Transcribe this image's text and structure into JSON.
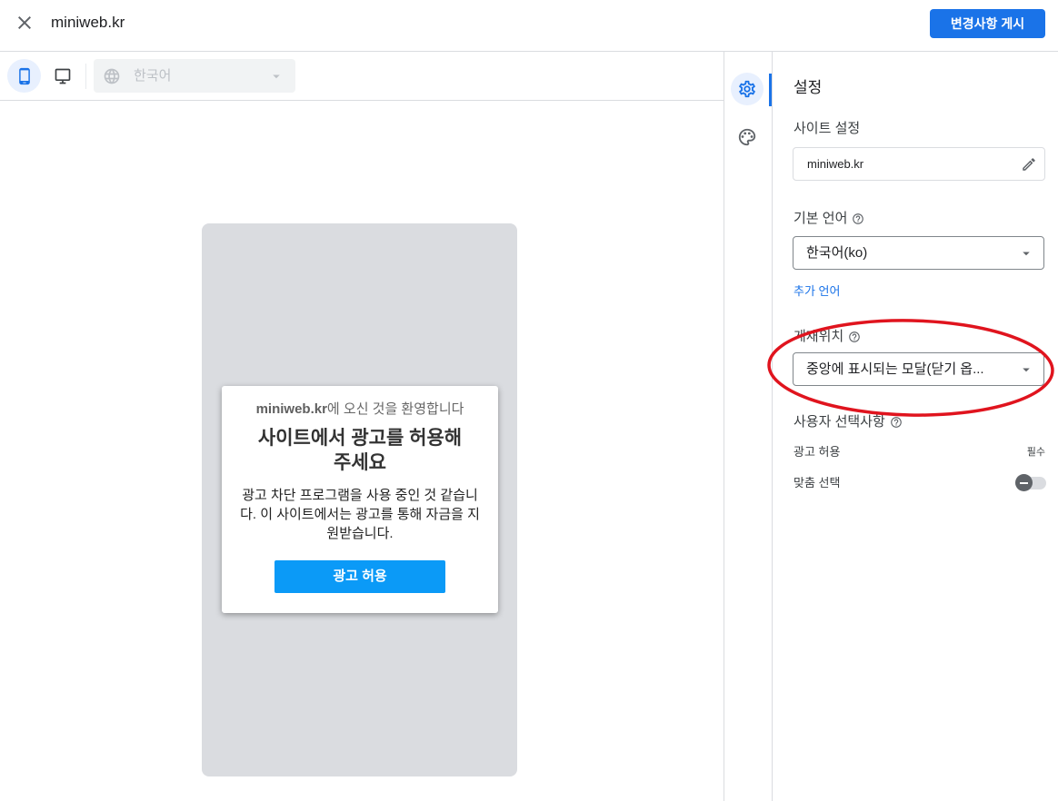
{
  "header": {
    "title": "miniweb.kr",
    "publish_label": "변경사항 게시"
  },
  "toolbar": {
    "mobile_selected": true,
    "language_value": "한국어",
    "language_disabled": true
  },
  "preview": {
    "welcome_site": "miniweb.kr",
    "welcome_suffix": "에 오신 것을 환영합니다",
    "title": "사이트에서 광고를 허용해 주세요",
    "body": "광고 차단 프로그램을 사용 중인 것 같습니다. 이 사이트에서는 광고를 통해 자금을 지원받습니다.",
    "allow_button": "광고 허용"
  },
  "rail": {
    "settings_selected": true
  },
  "settings": {
    "heading": "설정",
    "site_settings_label": "사이트 설정",
    "site_value": "miniweb.kr",
    "default_language_label": "기본 언어",
    "default_language_value": "한국어(ko)",
    "add_language_link": "추가 언어",
    "placement_label": "게재위치",
    "placement_value": "중앙에 표시되는 모달(닫기 옵...",
    "user_choices_label": "사용자 선택사항",
    "choices": [
      {
        "label": "광고 허용",
        "status": "필수"
      },
      {
        "label": "맞춤 선택",
        "enabled": false
      }
    ]
  },
  "colors": {
    "accent": "#1a73e8",
    "cta": "#0b9af7",
    "annotation": "#e0141e"
  },
  "icons": {
    "close": "close-icon",
    "mobile": "phone-icon",
    "desktop": "desktop-icon",
    "language": "globe-icon",
    "dropdown": "chevron-down-icon",
    "settings": "gear-icon",
    "theme": "palette-icon",
    "edit": "pencil-icon",
    "help": "help-icon"
  }
}
